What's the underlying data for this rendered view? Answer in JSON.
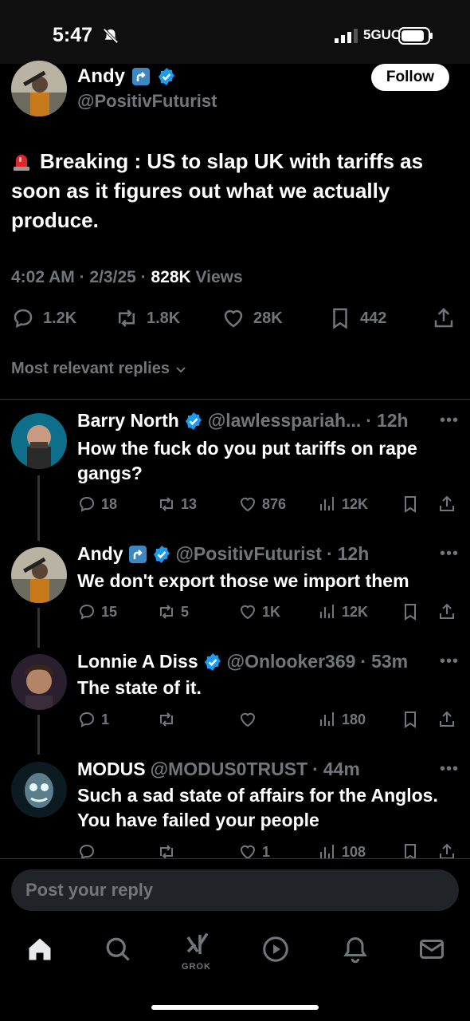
{
  "status_bar": {
    "time": "5:47",
    "network": "5GUC"
  },
  "tweet": {
    "author_name": "Andy",
    "author_handle": "@PositivFuturist",
    "follow_label": "Follow",
    "text": "Breaking : US to slap UK with tariffs as soon as it figures out what we actually produce.",
    "time": "4:02 AM",
    "date": "2/3/25",
    "views_count": "828K",
    "views_label": "Views",
    "replies": "1.2K",
    "reposts": "1.8K",
    "likes": "28K",
    "bookmarks": "442"
  },
  "replies_filter": "Most relevant replies",
  "replies": [
    {
      "name": "Barry North",
      "handle": "@lawlesspariah...",
      "time": "12h",
      "text": "How the fuck do you put tariffs on rape gangs?",
      "replies": "18",
      "reposts": "13",
      "likes": "876",
      "views": "12K"
    },
    {
      "name": "Andy",
      "handle": "@PositivFuturist",
      "time": "12h",
      "text": "We don't export those we import them",
      "replies": "15",
      "reposts": "5",
      "likes": "1K",
      "views": "12K"
    },
    {
      "name": "Lonnie A Diss",
      "handle": "@Onlooker369",
      "time": "53m",
      "text": "The state of it.",
      "replies": "1",
      "reposts": "",
      "likes": "",
      "views": "180"
    },
    {
      "name": "MODUS",
      "handle": "@MODUS0TRUST",
      "time": "44m",
      "text": "Such a sad state of affairs for the Anglos. You have failed your people",
      "replies": "",
      "reposts": "",
      "likes": "1",
      "views": "108"
    }
  ],
  "reply_box": {
    "placeholder": "Post your reply"
  },
  "nav": {
    "grok_label": "GROK"
  },
  "colors": {
    "accent": "#1d9bf0",
    "background": "#000000",
    "secondary_text": "#71767b"
  }
}
